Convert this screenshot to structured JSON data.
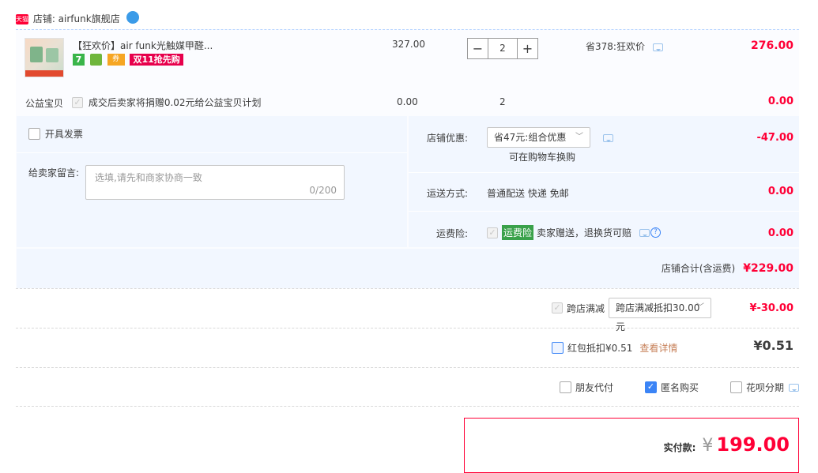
{
  "shop": {
    "badge": "天猫",
    "label": "店铺: airfunk旗舰店"
  },
  "product": {
    "title": "【狂欢价】air funk光触媒甲醛...",
    "price": "327.00",
    "qty": "2",
    "minus": "−",
    "plus": "+",
    "promo": "省378:狂欢价",
    "total": "276.00",
    "tag_double11": "双11抢先购",
    "tag_7": "7",
    "tag_coupon": "券"
  },
  "charity": {
    "label": "公益宝贝",
    "desc": "成交后卖家将捐赠0.02元给公益宝贝计划",
    "price": "0.00",
    "qty": "2",
    "total": "0.00"
  },
  "invoice": {
    "label": "开具发票"
  },
  "message": {
    "label": "给卖家留言:",
    "placeholder": "选填,请先和商家协商一致",
    "count": "0/200"
  },
  "discount": {
    "label": "店铺优惠:",
    "value": "省47元:组合优惠",
    "note": "可在购物车换购",
    "amount": "-47.00"
  },
  "shipping": {
    "label": "运送方式:",
    "value": "普通配送 快递 免邮",
    "amount": "0.00"
  },
  "insurance": {
    "label": "运费险:",
    "badge": "运费险",
    "desc": "卖家赠送，退换货可赔",
    "amount": "0.00"
  },
  "shop_total": {
    "label": "店铺合计(含运费)",
    "amount": "¥229.00"
  },
  "cross": {
    "label": "跨店满减",
    "value": "跨店满减抵扣30.00元",
    "amount": "¥-30.00"
  },
  "redpacket": {
    "label": "红包抵扣¥0.51",
    "link": "查看详情",
    "amount": "¥0.51"
  },
  "options": {
    "friend": "朋友代付",
    "anon": "匿名购买",
    "huabei": "花呗分期"
  },
  "pay": {
    "label": "实付款:",
    "currency": "¥",
    "amount": "199.00"
  },
  "colors": {
    "accent": "#ff0036",
    "panel": "#f2f7ff",
    "border_blue": "#b2d1ff"
  }
}
